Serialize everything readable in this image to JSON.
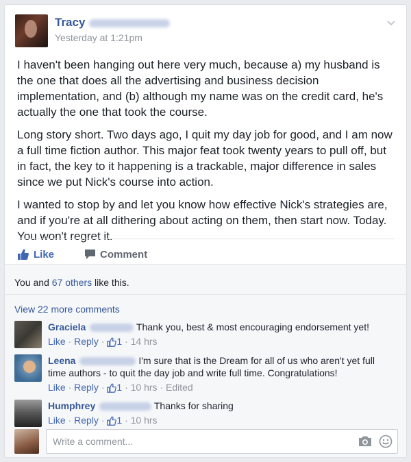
{
  "post": {
    "author_first": "Tracy",
    "timestamp": "Yesterday at 1:21pm",
    "paragraphs": [
      "I haven't been hanging out here very much, because a) my husband is the one that does all the advertising and business decision implementation, and (b) although my name was on the credit card, he's actually the one that took the course.",
      "Long story short. Two days ago, I quit my day job for good, and I am now a full time fiction author. This major feat took twenty years to pull off, but in fact, the key to it happening is a trackable, major difference in sales since we put Nick's course into action.",
      "I wanted to stop by and let you know how effective Nick's strategies are, and if you're at all dithering about acting on them, then start now. Today. You won't regret it."
    ],
    "actions": {
      "like": "Like",
      "comment": "Comment"
    }
  },
  "likes": {
    "prefix": "You and",
    "others": "67 others",
    "suffix": "like this."
  },
  "view_more": "View 22 more comments",
  "comments": [
    {
      "name": "Graciela",
      "text": "Thank you, best & most encouraging endorsement yet!",
      "like": "Like",
      "reply": "Reply",
      "count": "1",
      "time": "14 hrs",
      "edited": ""
    },
    {
      "name": "Leena",
      "text": "I'm sure that is the Dream for all of us who aren't yet full time authors - to quit the day job and write full time. Congratulations!",
      "like": "Like",
      "reply": "Reply",
      "count": "1",
      "time": "10 hrs",
      "edited": "Edited"
    },
    {
      "name": "Humphrey",
      "text": "Thanks for sharing",
      "like": "Like",
      "reply": "Reply",
      "count": "1",
      "time": "10 hrs",
      "edited": ""
    }
  ],
  "composer": {
    "placeholder": "Write a comment..."
  },
  "icons": {
    "chevron": "chevron-down-icon",
    "like": "thumbs-up-icon",
    "comment": "speech-bubble-icon",
    "camera": "camera-icon",
    "emoji": "smiley-icon"
  },
  "colors": {
    "link": "#365899",
    "accent": "#4267b2",
    "muted": "#90949c",
    "text": "#1d2129",
    "background": "#e9ebee"
  }
}
